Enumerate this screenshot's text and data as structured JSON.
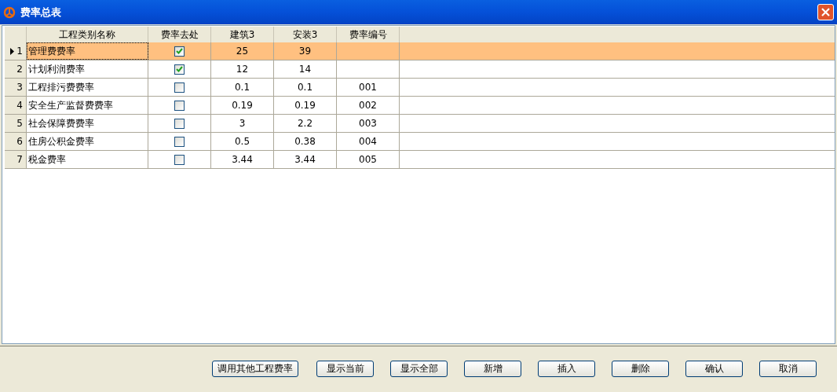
{
  "window": {
    "title": "费率总表"
  },
  "table": {
    "columns": [
      "工程类别名称",
      "费率去处",
      "建筑3",
      "安装3",
      "费率编号"
    ],
    "rows": [
      {
        "number": "1",
        "name": "管理费费率",
        "checked": true,
        "c3": "25",
        "c4": "39",
        "code": "",
        "selected": true
      },
      {
        "number": "2",
        "name": "计划利润费率",
        "checked": true,
        "c3": "12",
        "c4": "14",
        "code": "",
        "selected": false
      },
      {
        "number": "3",
        "name": "工程排污费费率",
        "checked": false,
        "c3": "0.1",
        "c4": "0.1",
        "code": "001",
        "selected": false
      },
      {
        "number": "4",
        "name": "安全生产监督费费率",
        "checked": false,
        "c3": "0.19",
        "c4": "0.19",
        "code": "002",
        "selected": false
      },
      {
        "number": "5",
        "name": "社会保障费费率",
        "checked": false,
        "c3": "3",
        "c4": "2.2",
        "code": "003",
        "selected": false
      },
      {
        "number": "6",
        "name": "住房公积金费率",
        "checked": false,
        "c3": "0.5",
        "c4": "0.38",
        "code": "004",
        "selected": false
      },
      {
        "number": "7",
        "name": "税金费率",
        "checked": false,
        "c3": "3.44",
        "c4": "3.44",
        "code": "005",
        "selected": false
      }
    ]
  },
  "buttons": [
    "调用其他工程费率",
    "显示当前",
    "显示全部",
    "新增",
    "插入",
    "删除",
    "确认",
    "取消"
  ]
}
